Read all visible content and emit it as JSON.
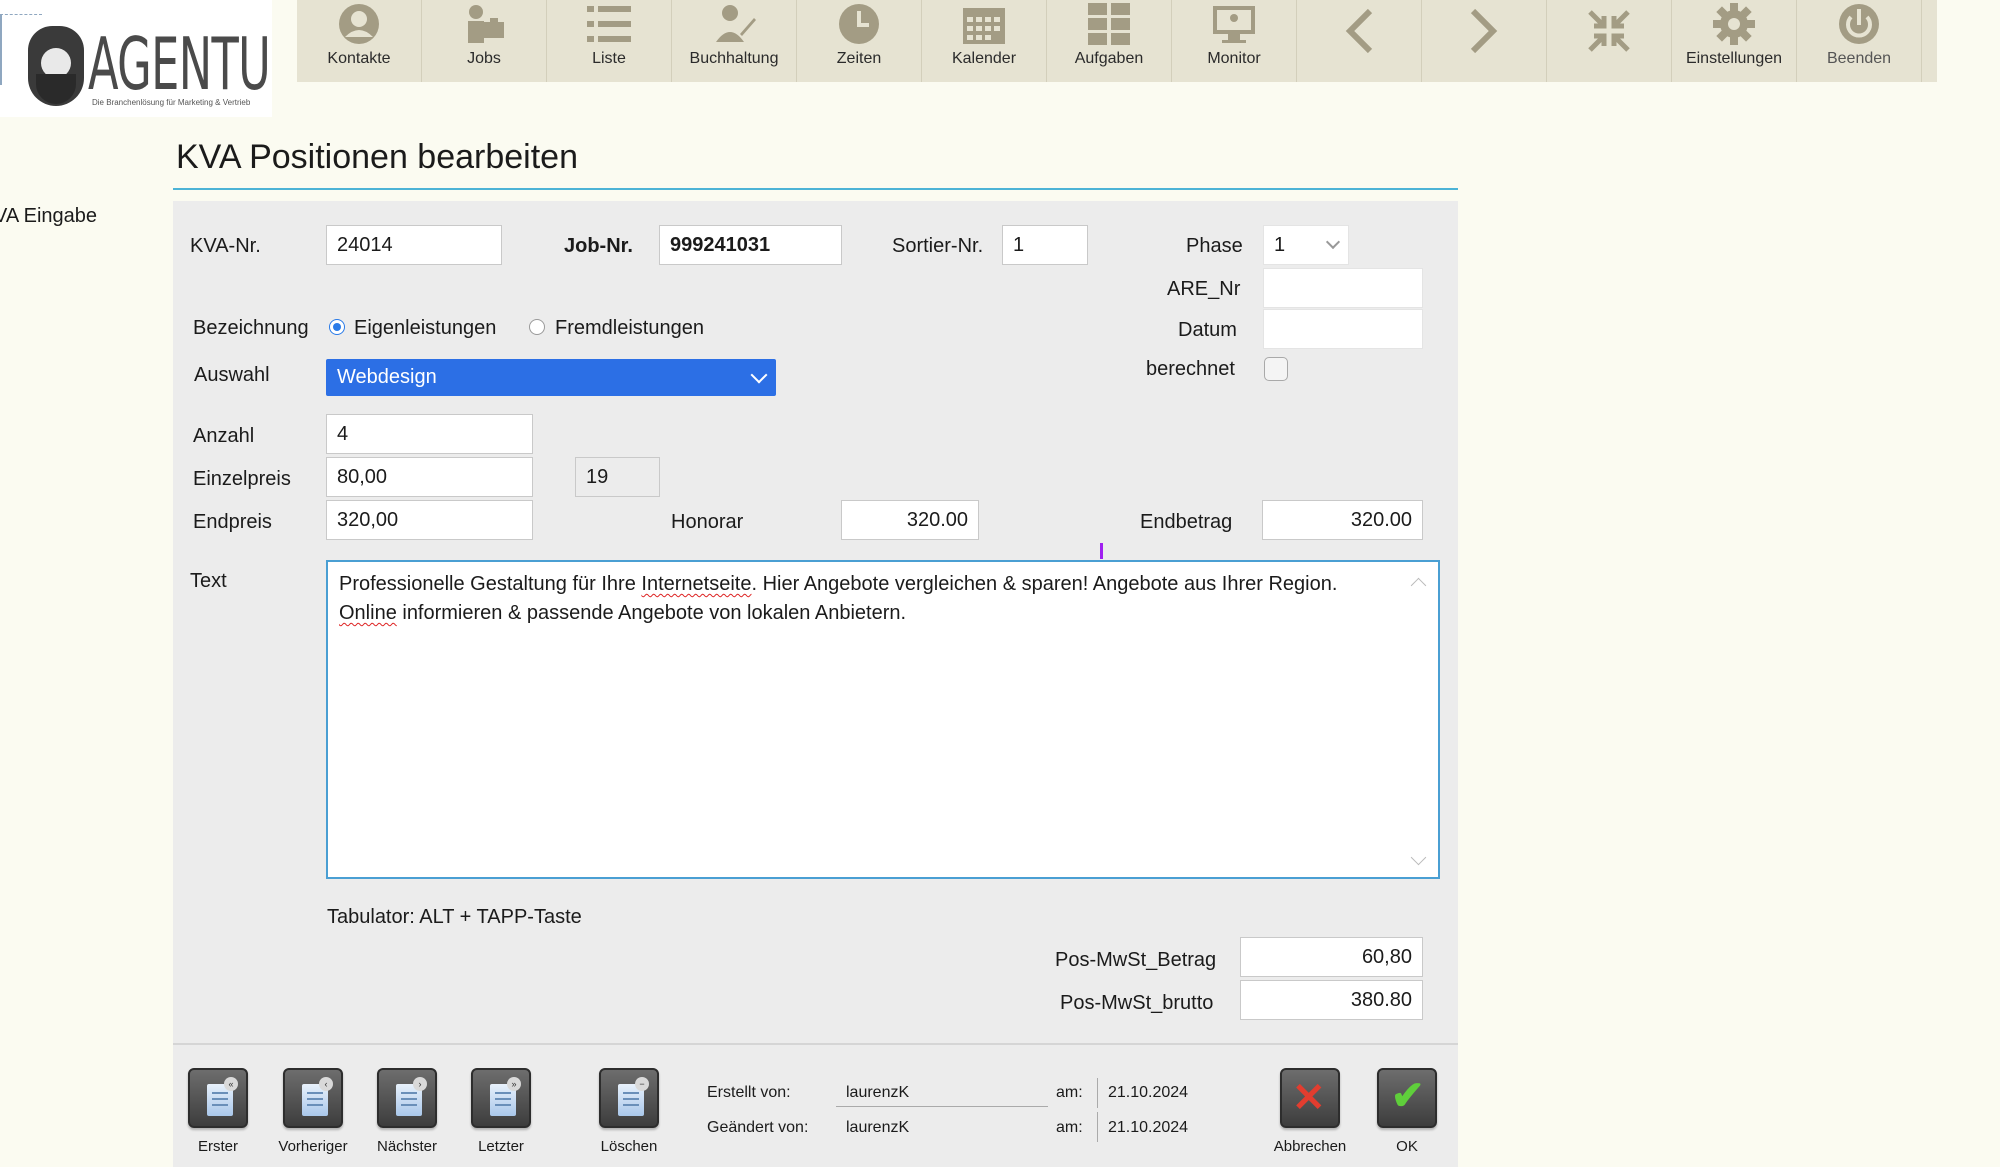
{
  "logo": {
    "name": "AGENTUR",
    "tagline": "Die Branchenlösung für Marketing & Vertrieb"
  },
  "toolbar": {
    "items": [
      {
        "label": "Kontakte",
        "icon": "person-icon"
      },
      {
        "label": "Jobs",
        "icon": "jobs-icon"
      },
      {
        "label": "Liste",
        "icon": "list-icon"
      },
      {
        "label": "Buchhaltung",
        "icon": "accounting-icon"
      },
      {
        "label": "Zeiten",
        "icon": "clock-icon"
      },
      {
        "label": "Kalender",
        "icon": "calendar-icon"
      },
      {
        "label": "Aufgaben",
        "icon": "tasks-grid-icon"
      },
      {
        "label": "Monitor",
        "icon": "monitor-icon"
      },
      {
        "label": "",
        "icon": "back-arrow-icon"
      },
      {
        "label": "",
        "icon": "forward-arrow-icon"
      },
      {
        "label": "",
        "icon": "collapse-icon"
      },
      {
        "label": "Einstellungen",
        "icon": "gear-icon"
      },
      {
        "label": "Beenden",
        "icon": "power-icon"
      }
    ]
  },
  "sidebar": {
    "label": "VA Eingabe"
  },
  "page": {
    "title": "KVA Positionen bearbeiten"
  },
  "form": {
    "kva_nr": {
      "label": "KVA-Nr.",
      "value": "24014"
    },
    "job_nr": {
      "label": "Job-Nr.",
      "value": "999241031"
    },
    "sortier_nr": {
      "label": "Sortier-Nr.",
      "value": "1"
    },
    "phase": {
      "label": "Phase",
      "value": "1"
    },
    "are_nr": {
      "label": "ARE_Nr",
      "value": ""
    },
    "datum": {
      "label": "Datum",
      "value": ""
    },
    "berechnet": {
      "label": "berechnet",
      "checked": false
    },
    "bezeichnung": {
      "label": "Bezeichnung",
      "options": [
        "Eigenleistungen",
        "Fremdleistungen"
      ],
      "selected": "Eigenleistungen"
    },
    "auswahl": {
      "label": "Auswahl",
      "value": "Webdesign"
    },
    "anzahl": {
      "label": "Anzahl",
      "value": "4"
    },
    "einzelpreis": {
      "label": "Einzelpreis",
      "value": "80,00"
    },
    "mwst_satz": {
      "value": "19"
    },
    "endpreis": {
      "label": "Endpreis",
      "value": "320,00"
    },
    "honorar": {
      "label": "Honorar",
      "value": "320.00"
    },
    "endbetrag": {
      "label": "Endbetrag",
      "value": "320.00"
    },
    "text": {
      "label": "Text",
      "part1": "Professionelle Gestaltung für Ihre ",
      "word1": "Internetseite",
      "part2": ". Hier Angebote vergleichen & sparen! Angebote aus Ihrer Region. ",
      "word2": "Online",
      "part3": " informieren & passende Angebote von lokalen Anbietern."
    },
    "hint": "Tabulator: ALT + TAPP-Taste",
    "pos_mwst_betrag": {
      "label": "Pos-MwSt_Betrag",
      "value": "60,80"
    },
    "pos_mwst_brutto": {
      "label": "Pos-MwSt_brutto",
      "value": "380.80"
    }
  },
  "footer": {
    "nav": [
      {
        "label": "Erster",
        "badge": "«"
      },
      {
        "label": "Vorheriger",
        "badge": "‹"
      },
      {
        "label": "Nächster",
        "badge": "›"
      },
      {
        "label": "Letzter",
        "badge": "»"
      }
    ],
    "delete_label": "Löschen",
    "created_by_label": "Erstellt von:",
    "created_by": "laurenzK",
    "changed_by_label": "Geändert von:",
    "changed_by": "laurenzK",
    "am_label": "am:",
    "created_date": "21.10.2024",
    "changed_date": "21.10.2024",
    "cancel_label": "Abbrechen",
    "ok_label": "OK"
  },
  "colors": {
    "toolbar_bg": "#e6e3d2",
    "accent_blue": "#2c6fe5",
    "cancel_red": "#e23d2f",
    "ok_green": "#5fcf3b"
  }
}
